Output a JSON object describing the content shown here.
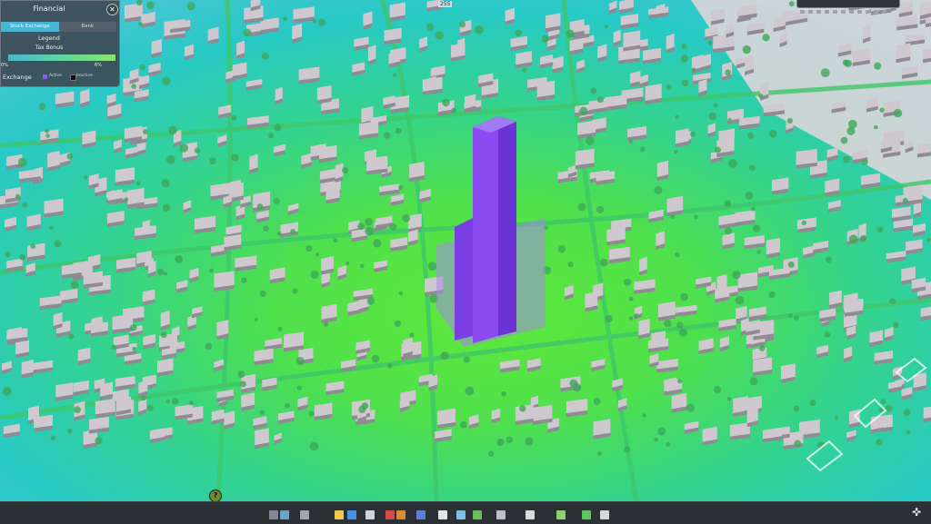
{
  "panel": {
    "title": "Financial",
    "close": "✕",
    "tabs": [
      {
        "label": "Stock Exchange",
        "active": true
      },
      {
        "label": "Bank",
        "active": false
      }
    ],
    "legend_title": "Legend",
    "tax_label": "Tax Bonus",
    "bar_min": "0%",
    "bar_max": "6%",
    "exchange_label": "Exchange",
    "active_label": "Active",
    "inactive_label": "Inactive",
    "active_color": "#8a5cf0",
    "inactive_color": "#111111"
  },
  "top_tag": "255",
  "help_glyph": "?",
  "settings_glyph": "✜",
  "toolbar": {
    "items": [
      {
        "name": "roads-icon",
        "color": "#7f8a94"
      },
      {
        "name": "zoning-icon",
        "color": "#6ea3c9"
      },
      {
        "name": "districts-icon",
        "color": "#9fa8b0"
      },
      {
        "name": "electricity-icon",
        "color": "#f2c94c"
      },
      {
        "name": "water-icon",
        "color": "#4a90e2"
      },
      {
        "name": "garbage-icon",
        "color": "#d0d4d8"
      },
      {
        "name": "healthcare-icon",
        "color": "#d84a4a"
      },
      {
        "name": "fire-icon",
        "color": "#e08a30"
      },
      {
        "name": "police-icon",
        "color": "#5d7fd6"
      },
      {
        "name": "education-icon",
        "color": "#e4e4e4"
      },
      {
        "name": "transport-icon",
        "color": "#7ec0e3"
      },
      {
        "name": "parks-icon",
        "color": "#6bbf59"
      },
      {
        "name": "monuments-icon",
        "color": "#b9c0c6"
      },
      {
        "name": "wonders-icon",
        "color": "#d9d9d9"
      },
      {
        "name": "terrain-icon",
        "color": "#8fd16a"
      },
      {
        "name": "bulldozer-icon",
        "color": "#5cc75c"
      },
      {
        "name": "policies-icon",
        "color": "#d7d7d7"
      }
    ]
  },
  "scene_colors": {
    "ground_green": "#55e23a",
    "ground_teal": "#2fd0b8",
    "tower": "#8247e8",
    "building": "#cfc9cf"
  }
}
